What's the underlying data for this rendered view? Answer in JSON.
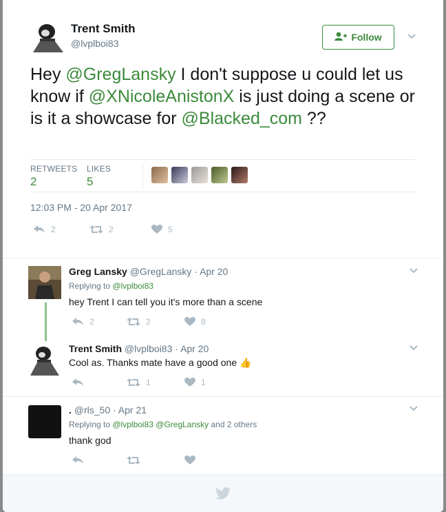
{
  "main_tweet": {
    "author_name": "Trent Smith",
    "author_handle": "@lvplboi83",
    "follow_label": "Follow",
    "text_parts": {
      "p1": "Hey ",
      "m1": "@GregLansky",
      "p2": " I don't suppose u could let us know if ",
      "m2": "@XNicoleAnistonX",
      "p3": " is just doing a scene or is it a showcase for ",
      "m3": "@Blacked_com",
      "p4": " ??"
    },
    "retweets_label": "RETWEETS",
    "retweets_count": "2",
    "likes_label": "LIKES",
    "likes_count": "5",
    "timestamp": "12:03 PM - 20 Apr 2017",
    "actions": {
      "reply": "2",
      "retweet": "2",
      "like": "5"
    }
  },
  "replies": [
    {
      "name": "Greg Lansky",
      "handle": "@GregLansky",
      "sep": " · ",
      "date": "Apr 20",
      "replying_prefix": "Replying to ",
      "replying_to": "@lvplboi83",
      "text": "hey Trent I can tell you it's more than a scene",
      "actions": {
        "reply": "2",
        "retweet": "2",
        "like": "8"
      }
    },
    {
      "name": "Trent Smith",
      "handle": "@lvplboi83",
      "sep": " · ",
      "date": "Apr 20",
      "text": "Cool as. Thanks mate have a good one",
      "emoji": "👍",
      "actions": {
        "reply": "",
        "retweet": "1",
        "like": "1"
      }
    },
    {
      "name": ".",
      "handle": "@rls_50",
      "sep": " · ",
      "date": "Apr 21",
      "replying_prefix": "Replying to ",
      "replying_to": "@lvplboi83 @GregLansky",
      "replying_suffix": " and 2 others",
      "text": "thank god",
      "actions": {
        "reply": "",
        "retweet": "",
        "like": ""
      }
    }
  ],
  "colors": {
    "accent": "#3b8a3b",
    "muted": "#657786",
    "icon": "#aab8c2",
    "footer_logo": "#ccd6dd"
  },
  "icons": [
    "follow-person-icon",
    "chevron-down-icon",
    "reply-icon",
    "retweet-icon",
    "heart-icon",
    "twitter-bird-icon"
  ]
}
